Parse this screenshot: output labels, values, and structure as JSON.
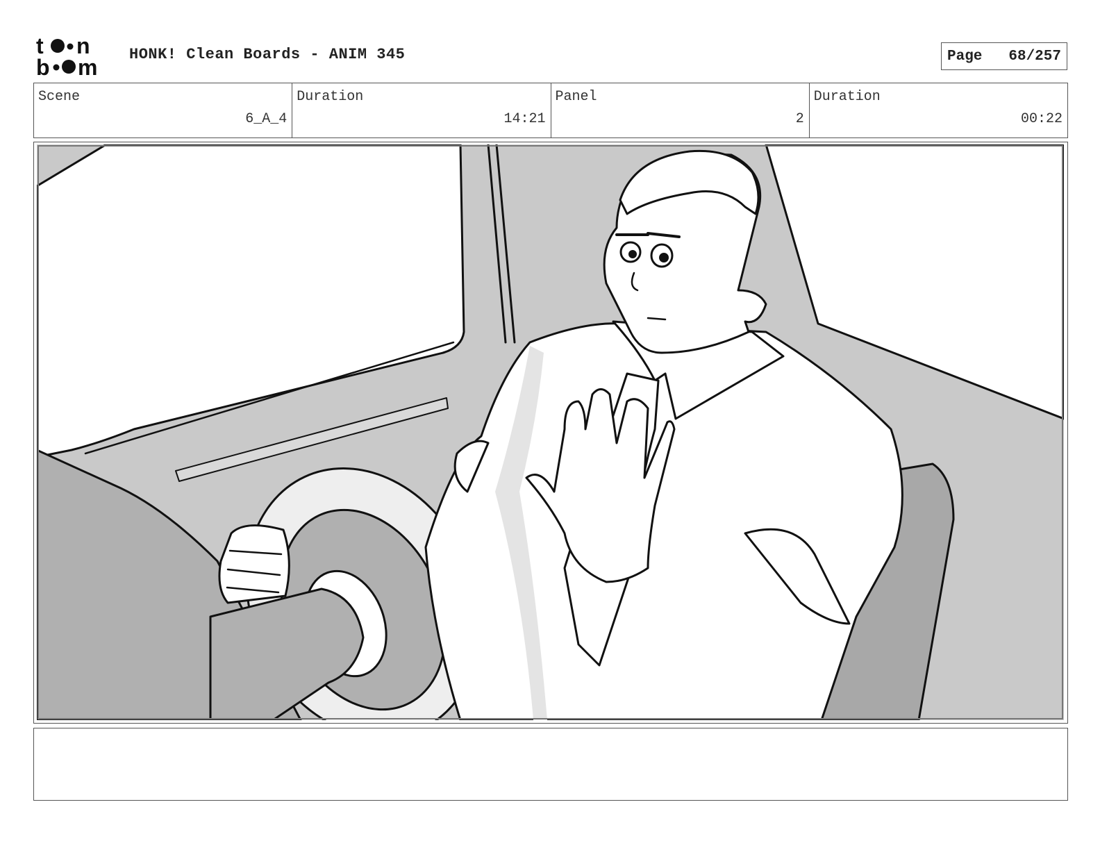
{
  "header": {
    "logo_text": "toon boom",
    "title": "HONK! Clean Boards - ANIM 345",
    "page_label": "Page",
    "page_number": "68/257"
  },
  "info": {
    "scene_label": "Scene",
    "scene_value": "6_A_4",
    "scene_duration_label": "Duration",
    "scene_duration_value": "14:21",
    "panel_label": "Panel",
    "panel_value": "2",
    "panel_duration_label": "Duration",
    "panel_duration_value": "00:22"
  },
  "panel_image": {
    "icon": "storyboard-sketch",
    "subject": "man in short-sleeved shirt and tie raising hand while driving"
  },
  "notes": {
    "text": ""
  }
}
